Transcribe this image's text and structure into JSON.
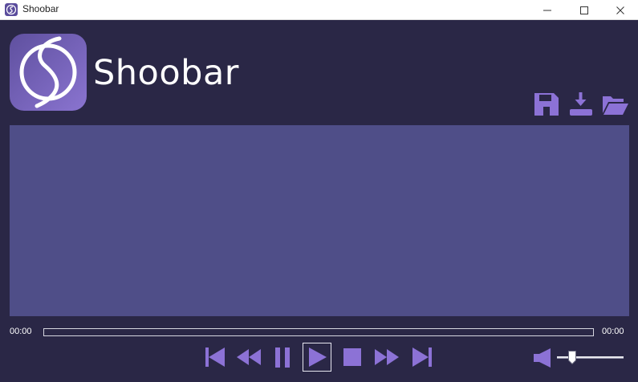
{
  "window": {
    "title": "Shoobar",
    "controls": [
      "minimize",
      "maximize",
      "close"
    ]
  },
  "header": {
    "app_name": "Shoobar",
    "logo_icon": "shoobar-logo-icon"
  },
  "toolbar": {
    "items": [
      {
        "name": "save",
        "icon": "floppy-disk-icon"
      },
      {
        "name": "download",
        "icon": "download-icon"
      },
      {
        "name": "open",
        "icon": "folder-open-icon"
      }
    ]
  },
  "player": {
    "current_time": "00:00",
    "total_time": "00:00",
    "progress": 0,
    "volume": 0.2,
    "controls": [
      {
        "name": "previous",
        "icon": "skip-back-icon"
      },
      {
        "name": "rewind",
        "icon": "rewind-icon"
      },
      {
        "name": "pause",
        "icon": "pause-icon"
      },
      {
        "name": "play",
        "icon": "play-icon",
        "focused": true
      },
      {
        "name": "stop",
        "icon": "stop-icon"
      },
      {
        "name": "fast-forward",
        "icon": "fast-forward-icon"
      },
      {
        "name": "next",
        "icon": "skip-forward-icon"
      }
    ]
  },
  "colors": {
    "background": "#2a2746",
    "video_area": "#4f4e88",
    "accent": "#8c72d6",
    "text": "#ffffff"
  }
}
